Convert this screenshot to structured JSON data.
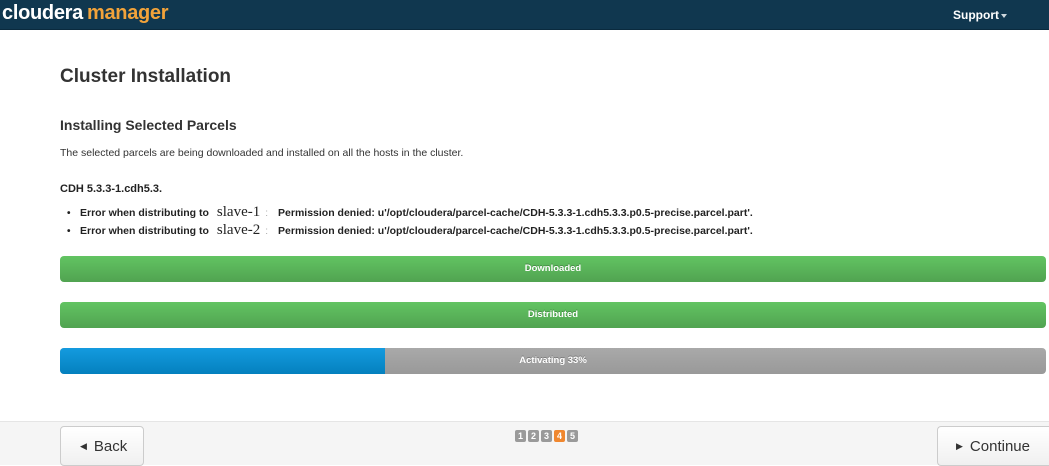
{
  "app": {
    "logo_part1": "cloudera",
    "logo_part2": "manager",
    "support_label": "Support"
  },
  "page": {
    "title": "Cluster Installation",
    "section_title": "Installing Selected Parcels",
    "description": "The selected parcels are being downloaded and installed on all the hosts in the cluster."
  },
  "parcel": {
    "name": "CDH 5.3.3-1.cdh5.3.",
    "errors": [
      {
        "bullet": "•",
        "prefix": "Error when distributing to",
        "host": "slave-1",
        "separator": ":",
        "message": "Permission denied: u'/opt/cloudera/parcel-cache/CDH-5.3.3-1.cdh5.3.3.p0.5-precise.parcel.part'."
      },
      {
        "bullet": "•",
        "prefix": "Error when distributing to",
        "host": "slave-2",
        "separator": ":",
        "message": "Permission denied: u'/opt/cloudera/parcel-cache/CDH-5.3.3-1.cdh5.3.3.p0.5-precise.parcel.part'."
      }
    ]
  },
  "progress": [
    {
      "label": "Downloaded",
      "percent": 100,
      "status": "complete"
    },
    {
      "label": "Distributed",
      "percent": 100,
      "status": "complete"
    },
    {
      "label": "Activating 33%",
      "percent": 33,
      "status": "active"
    }
  ],
  "wizard": {
    "back_label": "Back",
    "continue_label": "Continue",
    "steps": [
      "1",
      "2",
      "3",
      "4",
      "5"
    ],
    "current_step": "4"
  },
  "colors": {
    "topbar": "#10374f",
    "logo_accent": "#f2a33a",
    "progress_complete": "#5cb85c",
    "progress_active": "#1b8fd2",
    "progress_track": "#a0a0a0",
    "step_active": "#f0872f",
    "step_inactive": "#9a9a9a"
  }
}
